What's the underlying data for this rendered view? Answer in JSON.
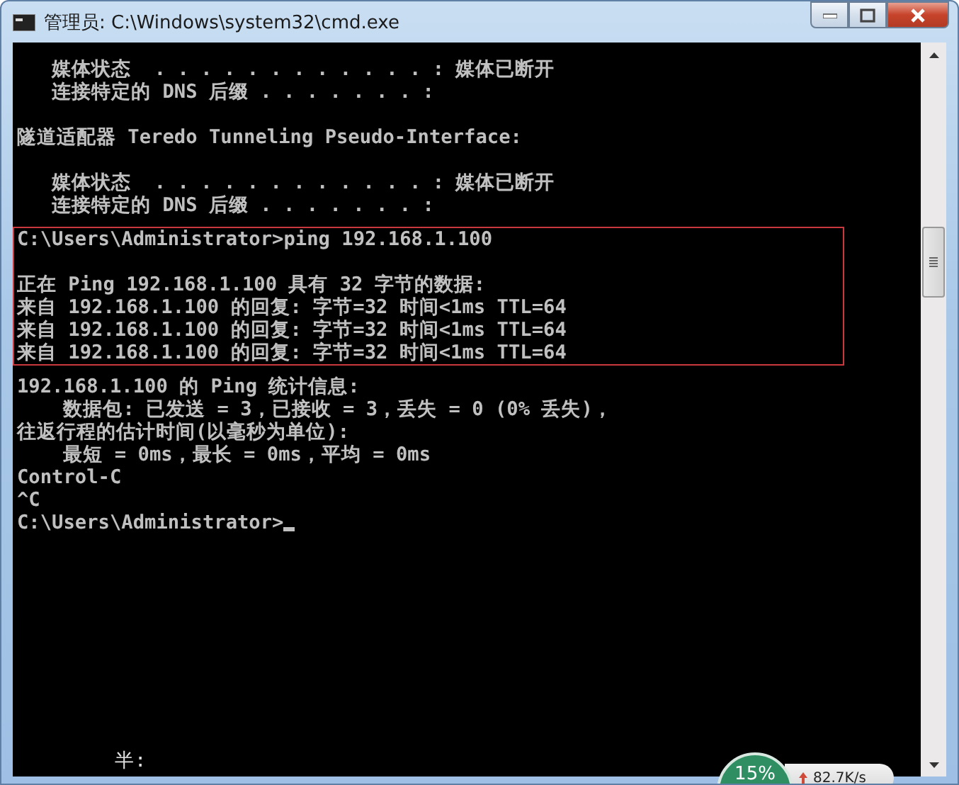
{
  "window": {
    "title": "管理员: C:\\Windows\\system32\\cmd.exe"
  },
  "console": {
    "sections": [
      {
        "highlighted": false,
        "blocks": [
          [
            "   媒体状态  . . . . . . . . . . . . : 媒体已断开",
            "   连接特定的 DNS 后缀 . . . . . . . :"
          ],
          [
            "隧道适配器 Teredo Tunneling Pseudo-Interface:"
          ],
          [
            "   媒体状态  . . . . . . . . . . . . : 媒体已断开",
            "   连接特定的 DNS 后缀 . . . . . . . :"
          ]
        ]
      },
      {
        "highlighted": true,
        "blocks": [
          [
            "C:\\Users\\Administrator>ping 192.168.1.100"
          ],
          [
            "正在 Ping 192.168.1.100 具有 32 字节的数据:",
            "来自 192.168.1.100 的回复: 字节=32 时间<1ms TTL=64",
            "来自 192.168.1.100 的回复: 字节=32 时间<1ms TTL=64",
            "来自 192.168.1.100 的回复: 字节=32 时间<1ms TTL=64"
          ]
        ]
      },
      {
        "highlighted": false,
        "blocks": [
          [
            "192.168.1.100 的 Ping 统计信息:",
            "    数据包: 已发送 = 3，已接收 = 3，丢失 = 0 (0% 丢失)，",
            "往返行程的估计时间(以毫秒为单位):",
            "    最短 = 0ms，最长 = 0ms，平均 = 0ms",
            "Control-C",
            "^C",
            "C:\\Users\\Administrator>"
          ]
        ]
      }
    ],
    "cursor": true,
    "ime_text": "半:"
  },
  "widget": {
    "cpu": "15%",
    "speed": "82.7K/s"
  }
}
